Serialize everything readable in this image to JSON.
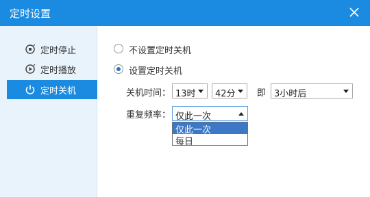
{
  "window": {
    "title": "定时设置"
  },
  "sidebar": {
    "items": [
      {
        "label": "定时停止",
        "icon": "timer-stop-icon",
        "active": false
      },
      {
        "label": "定时播放",
        "icon": "timer-play-icon",
        "active": false
      },
      {
        "label": "定时关机",
        "icon": "power-icon",
        "active": true
      }
    ]
  },
  "main": {
    "options": [
      {
        "label": "不设置定时关机",
        "checked": false
      },
      {
        "label": "设置定时关机",
        "checked": true
      }
    ],
    "shutdown_time_label": "关机时间：",
    "hour_value": "13时",
    "minute_value": "42分",
    "ji_label": "即",
    "after_value": "3小时后",
    "repeat_label": "重复频率：",
    "repeat_value": "仅此一次",
    "repeat_options": [
      "仅此一次",
      "每日"
    ]
  },
  "colors": {
    "accent": "#1a8be0",
    "sidebar_bg": "#e9f3fb",
    "highlight": "#3c78c6"
  }
}
